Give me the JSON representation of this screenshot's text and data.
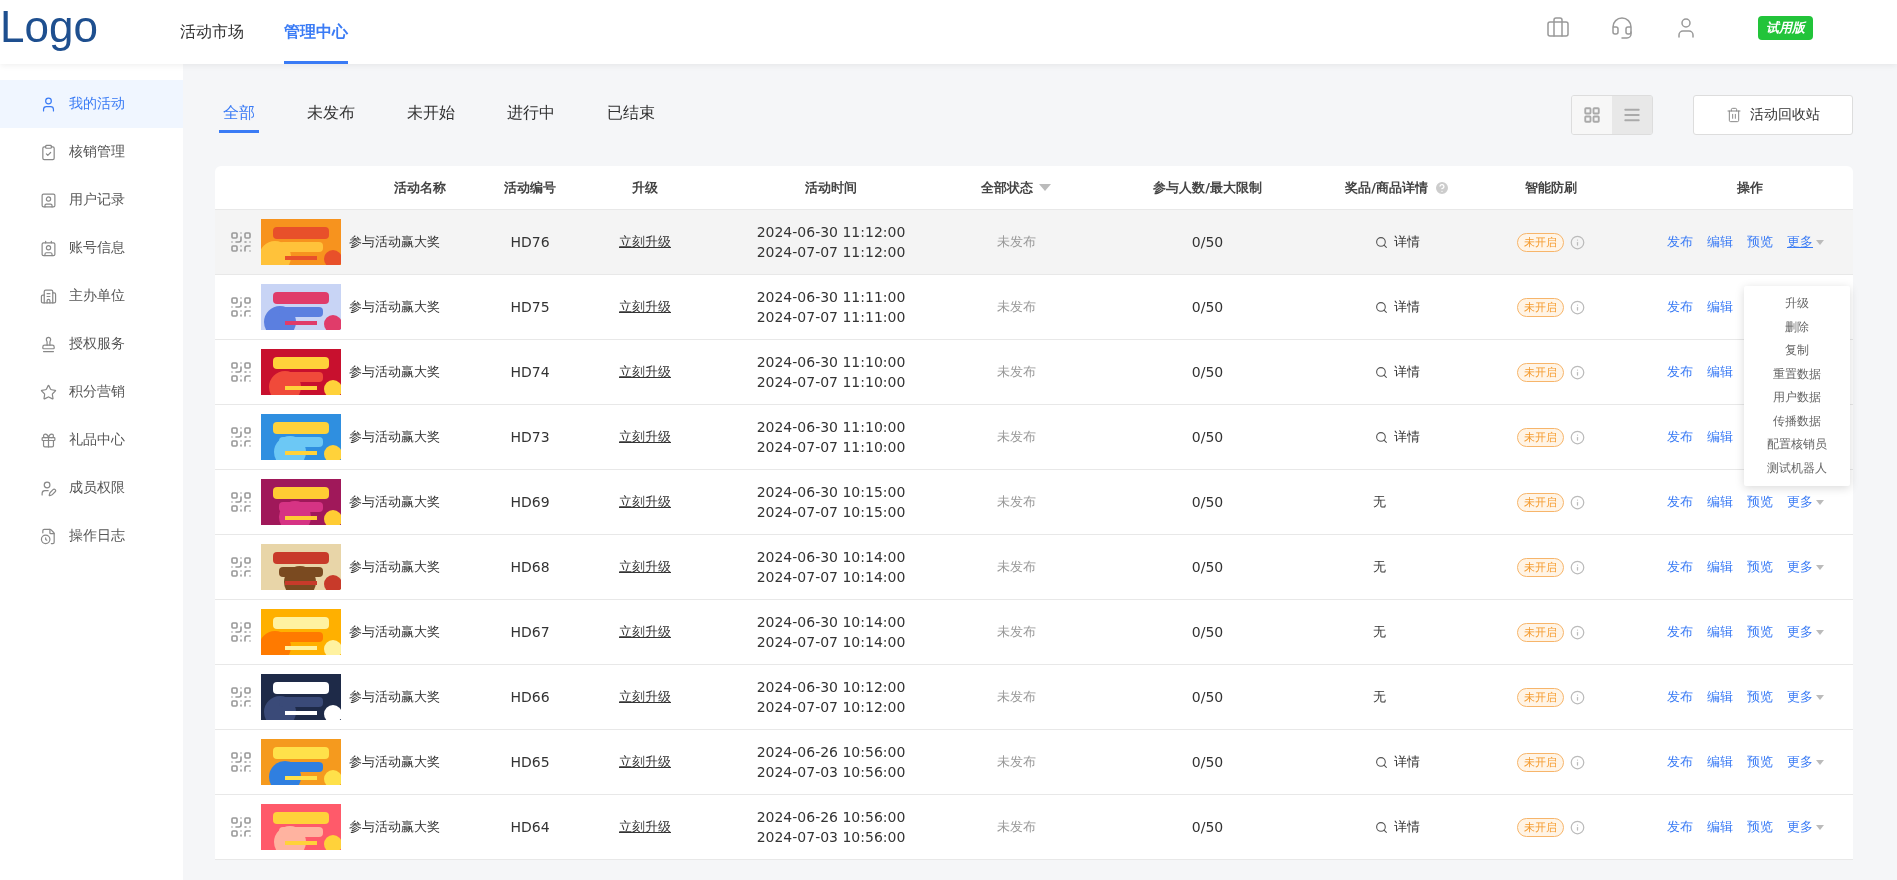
{
  "header": {
    "logo": "Logo",
    "nav": [
      {
        "label": "活动市场",
        "selected": false
      },
      {
        "label": "管理中心",
        "selected": true
      }
    ],
    "badge": "试用版"
  },
  "sidebar": {
    "items": [
      {
        "label": "我的活动",
        "selected": true
      },
      {
        "label": "核销管理",
        "selected": false
      },
      {
        "label": "用户记录",
        "selected": false
      },
      {
        "label": "账号信息",
        "selected": false
      },
      {
        "label": "主办单位",
        "selected": false
      },
      {
        "label": "授权服务",
        "selected": false
      },
      {
        "label": "积分营销",
        "selected": false
      },
      {
        "label": "礼品中心",
        "selected": false
      },
      {
        "label": "成员权限",
        "selected": false
      },
      {
        "label": "操作日志",
        "selected": false
      }
    ]
  },
  "tabs": [
    {
      "label": "全部",
      "selected": true
    },
    {
      "label": "未发布",
      "selected": false
    },
    {
      "label": "未开始",
      "selected": false
    },
    {
      "label": "进行中",
      "selected": false
    },
    {
      "label": "已结束",
      "selected": false
    }
  ],
  "view_toggle": [
    {
      "kind": "grid",
      "selected": false
    },
    {
      "kind": "list",
      "selected": true
    }
  ],
  "recycle_button": "活动回收站",
  "table": {
    "columns": [
      {
        "label": "活动名称",
        "kind": "plain"
      },
      {
        "label": "活动编号",
        "kind": "plain"
      },
      {
        "label": "升级",
        "kind": "plain"
      },
      {
        "label": "活动时间",
        "kind": "plain"
      },
      {
        "label": "全部状态",
        "kind": "filter"
      },
      {
        "label": "参与人数/最大限制",
        "kind": "plain"
      },
      {
        "label": "奖品/商品详情",
        "kind": "help"
      },
      {
        "label": "智能防刷",
        "kind": "plain"
      },
      {
        "label": "操作",
        "kind": "plain"
      }
    ],
    "rows": [
      {
        "highlighted": true,
        "name": "参与活动赢大奖",
        "code": "HD76",
        "upgrade": "立刻升级",
        "start": "2024-06-30 11:12:00",
        "end": "2024-07-07 11:12:00",
        "status": "未发布",
        "participants": "0/50",
        "prize": {
          "kind": "link",
          "label": "详情"
        },
        "guard": "未开启",
        "actions": [
          {
            "kind": "link",
            "label": "发布"
          },
          {
            "kind": "link",
            "label": "编辑"
          },
          {
            "kind": "link",
            "label": "预览"
          },
          {
            "kind": "menu",
            "label": "更多"
          }
        ]
      },
      {
        "name": "参与活动赢大奖",
        "code": "HD75",
        "upgrade": "立刻升级",
        "start": "2024-06-30 11:11:00",
        "end": "2024-07-07 11:11:00",
        "status": "未发布",
        "participants": "0/50",
        "prize": {
          "kind": "link",
          "label": "详情"
        },
        "guard": "未开启",
        "actions": [
          {
            "kind": "link",
            "label": "发布"
          },
          {
            "kind": "link",
            "label": "编辑"
          }
        ]
      },
      {
        "name": "参与活动赢大奖",
        "code": "HD74",
        "upgrade": "立刻升级",
        "start": "2024-06-30 11:10:00",
        "end": "2024-07-07 11:10:00",
        "status": "未发布",
        "participants": "0/50",
        "prize": {
          "kind": "link",
          "label": "详情"
        },
        "guard": "未开启",
        "actions": [
          {
            "kind": "link",
            "label": "发布"
          },
          {
            "kind": "link",
            "label": "编辑"
          }
        ]
      },
      {
        "name": "参与活动赢大奖",
        "code": "HD73",
        "upgrade": "立刻升级",
        "start": "2024-06-30 11:10:00",
        "end": "2024-07-07 11:10:00",
        "status": "未发布",
        "participants": "0/50",
        "prize": {
          "kind": "link",
          "label": "详情"
        },
        "guard": "未开启",
        "actions": [
          {
            "kind": "link",
            "label": "发布"
          },
          {
            "kind": "link",
            "label": "编辑"
          }
        ]
      },
      {
        "name": "参与活动赢大奖",
        "code": "HD69",
        "upgrade": "立刻升级",
        "start": "2024-06-30 10:15:00",
        "end": "2024-07-07 10:15:00",
        "status": "未发布",
        "participants": "0/50",
        "prize": {
          "kind": "none",
          "label": "无"
        },
        "guard": "未开启",
        "actions": [
          {
            "kind": "link",
            "label": "发布"
          },
          {
            "kind": "link",
            "label": "编辑"
          },
          {
            "kind": "link",
            "label": "预览"
          },
          {
            "kind": "menu",
            "label": "更多"
          }
        ]
      },
      {
        "name": "参与活动赢大奖",
        "code": "HD68",
        "upgrade": "立刻升级",
        "start": "2024-06-30 10:14:00",
        "end": "2024-07-07 10:14:00",
        "status": "未发布",
        "participants": "0/50",
        "prize": {
          "kind": "none",
          "label": "无"
        },
        "guard": "未开启",
        "actions": [
          {
            "kind": "link",
            "label": "发布"
          },
          {
            "kind": "link",
            "label": "编辑"
          },
          {
            "kind": "link",
            "label": "预览"
          },
          {
            "kind": "menu",
            "label": "更多"
          }
        ]
      },
      {
        "name": "参与活动赢大奖",
        "code": "HD67",
        "upgrade": "立刻升级",
        "start": "2024-06-30 10:14:00",
        "end": "2024-07-07 10:14:00",
        "status": "未发布",
        "participants": "0/50",
        "prize": {
          "kind": "none",
          "label": "无"
        },
        "guard": "未开启",
        "actions": [
          {
            "kind": "link",
            "label": "发布"
          },
          {
            "kind": "link",
            "label": "编辑"
          },
          {
            "kind": "link",
            "label": "预览"
          },
          {
            "kind": "menu",
            "label": "更多"
          }
        ]
      },
      {
        "name": "参与活动赢大奖",
        "code": "HD66",
        "upgrade": "立刻升级",
        "start": "2024-06-30 10:12:00",
        "end": "2024-07-07 10:12:00",
        "status": "未发布",
        "participants": "0/50",
        "prize": {
          "kind": "none",
          "label": "无"
        },
        "guard": "未开启",
        "actions": [
          {
            "kind": "link",
            "label": "发布"
          },
          {
            "kind": "link",
            "label": "编辑"
          },
          {
            "kind": "link",
            "label": "预览"
          },
          {
            "kind": "menu",
            "label": "更多"
          }
        ]
      },
      {
        "name": "参与活动赢大奖",
        "code": "HD65",
        "upgrade": "立刻升级",
        "start": "2024-06-26 10:56:00",
        "end": "2024-07-03 10:56:00",
        "status": "未发布",
        "participants": "0/50",
        "prize": {
          "kind": "link",
          "label": "详情"
        },
        "guard": "未开启",
        "actions": [
          {
            "kind": "link",
            "label": "发布"
          },
          {
            "kind": "link",
            "label": "编辑"
          },
          {
            "kind": "link",
            "label": "预览"
          },
          {
            "kind": "menu",
            "label": "更多"
          }
        ]
      },
      {
        "name": "参与活动赢大奖",
        "code": "HD64",
        "upgrade": "立刻升级",
        "start": "2024-06-26 10:56:00",
        "end": "2024-07-03 10:56:00",
        "status": "未发布",
        "participants": "0/50",
        "prize": {
          "kind": "link",
          "label": "详情"
        },
        "guard": "未开启",
        "actions": [
          {
            "kind": "link",
            "label": "发布"
          },
          {
            "kind": "link",
            "label": "编辑"
          },
          {
            "kind": "link",
            "label": "预览"
          },
          {
            "kind": "menu",
            "label": "更多"
          }
        ]
      }
    ]
  },
  "dropdown": {
    "items": [
      "升级",
      "删除",
      "复制",
      "重置数据",
      "用户数据",
      "传播数据",
      "配置核销员",
      "测试机器人"
    ]
  }
}
